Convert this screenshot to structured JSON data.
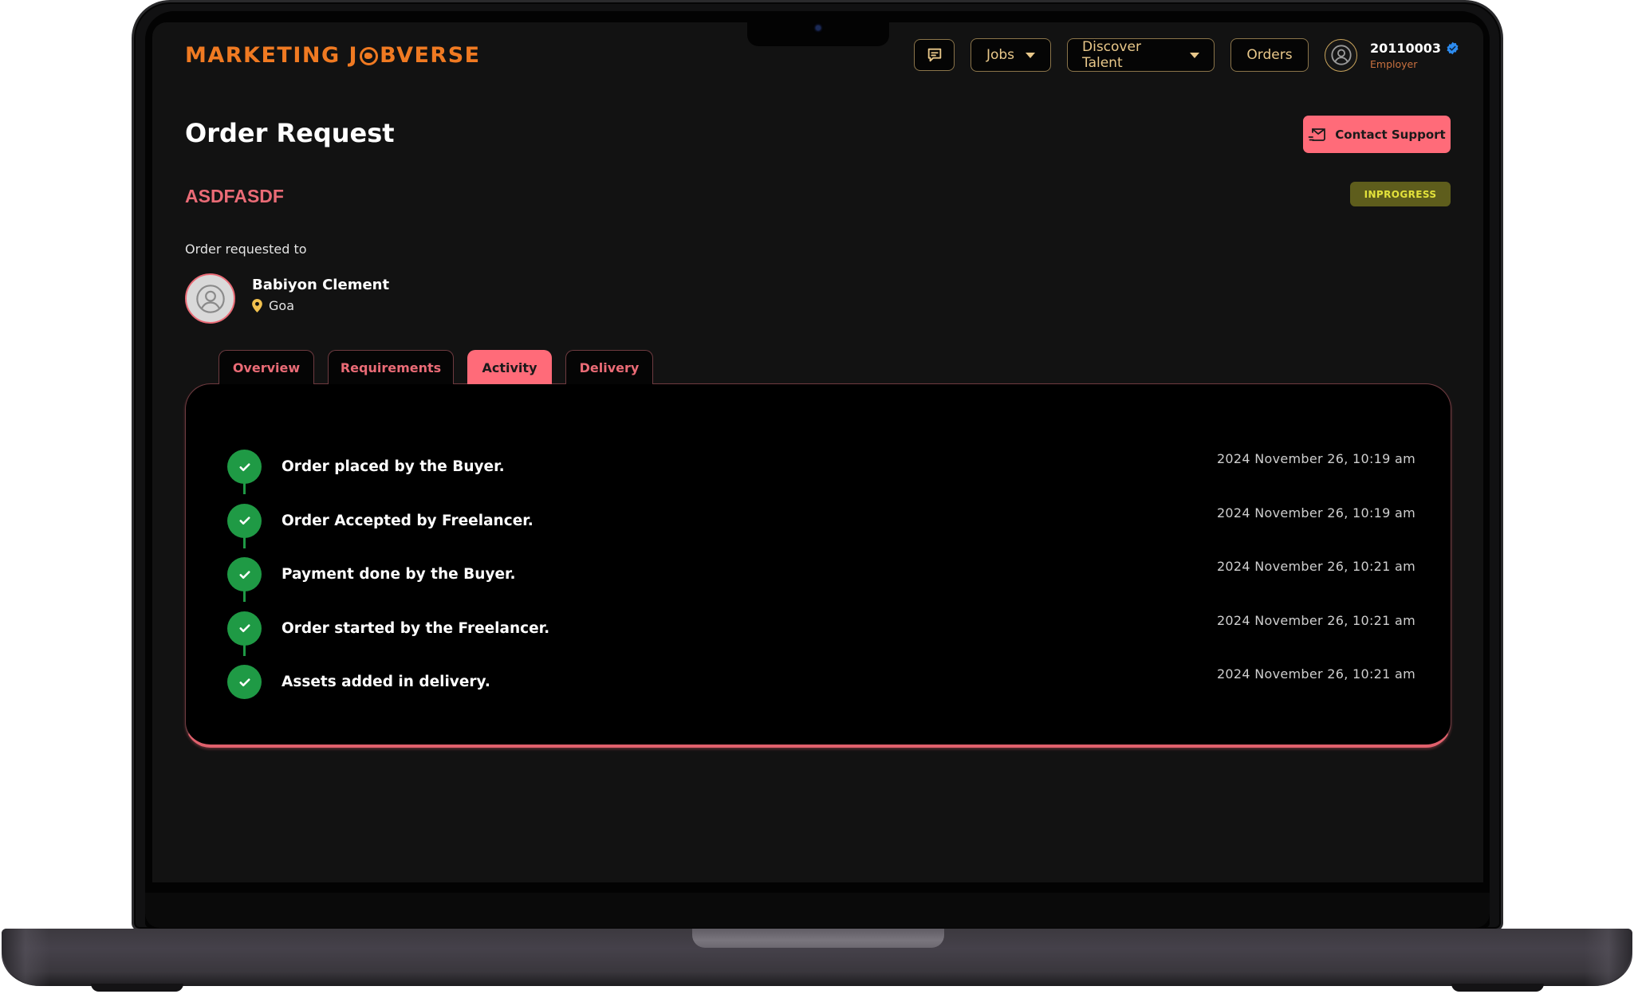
{
  "brand": {
    "logo_left": "MARKETING J",
    "logo_right": "BVERSE",
    "logo_icon": "globe-icon",
    "color": "#f07a22"
  },
  "nav": {
    "messages_icon": "chat-icon",
    "jobs_label": "Jobs",
    "discover_label": "Discover Talent",
    "orders_label": "Orders",
    "user": {
      "id": "20110003",
      "role": "Employer",
      "verified": true,
      "avatar_icon": "user-circle-icon"
    }
  },
  "page": {
    "title": "Order Request",
    "order_code": "ASDFASDF",
    "status": "INPROGRESS",
    "contact_support_label": "Contact Support",
    "requested_to_label": "Order requested to",
    "freelancer": {
      "name": "Babiyon Clement",
      "location": "Goa"
    }
  },
  "tabs": [
    {
      "label": "Overview",
      "active": false
    },
    {
      "label": "Requirements",
      "active": false
    },
    {
      "label": "Activity",
      "active": true
    },
    {
      "label": "Delivery",
      "active": false
    }
  ],
  "activity": [
    {
      "text": "Order placed by the Buyer.",
      "time": "2024 November 26, 10:19 am",
      "done": true
    },
    {
      "text": "Order Accepted by Freelancer.",
      "time": "2024 November 26, 10:19 am",
      "done": true
    },
    {
      "text": "Payment done by the Buyer.",
      "time": "2024 November 26, 10:21 am",
      "done": true
    },
    {
      "text": "Order started by the Freelancer.",
      "time": "2024 November 26, 10:21 am",
      "done": true
    },
    {
      "text": "Assets added in delivery.",
      "time": "2024 November 26, 10:21 am",
      "done": true
    }
  ],
  "colors": {
    "accent": "#ff6b79",
    "accent_text": "#ea6b76",
    "nav_gold": "#e9c88a",
    "success": "#1f9a45",
    "status_bg": "#5e5d1c",
    "status_text": "#e3e23b",
    "verified_blue": "#2d8cf0"
  }
}
